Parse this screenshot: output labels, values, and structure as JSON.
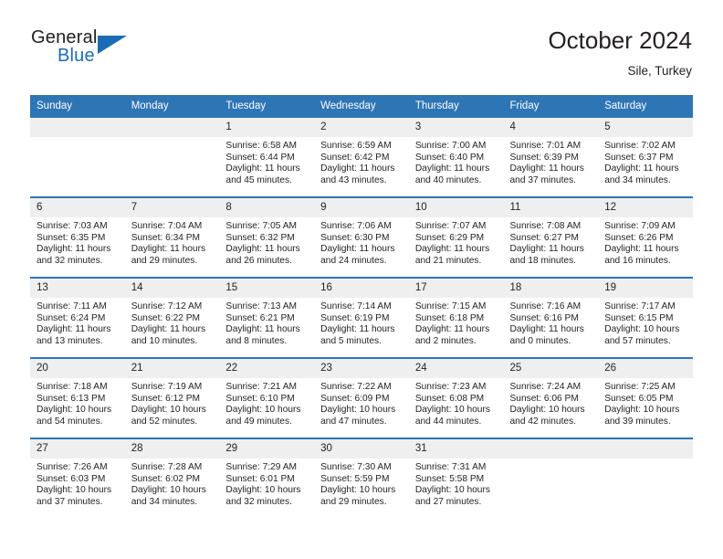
{
  "brand": {
    "name_top": "General",
    "name_bottom": "Blue",
    "accent_color": "#1b6cb5",
    "logo_icon": "blue-triangle-icon"
  },
  "header": {
    "title": "October 2024",
    "subtitle": "Sile, Turkey"
  },
  "colors": {
    "header_row_background": "#2e75b6",
    "header_row_text": "#ffffff",
    "daynumber_band_background": "#efefef",
    "cell_divider": "#2e75b6",
    "body_text": "#231f20"
  },
  "weekday_headers": [
    "Sunday",
    "Monday",
    "Tuesday",
    "Wednesday",
    "Thursday",
    "Friday",
    "Saturday"
  ],
  "weeks": [
    [
      {
        "day": "",
        "sunrise": "",
        "sunset": "",
        "daylight_line1": "",
        "daylight_line2": ""
      },
      {
        "day": "",
        "sunrise": "",
        "sunset": "",
        "daylight_line1": "",
        "daylight_line2": ""
      },
      {
        "day": "1",
        "sunrise": "Sunrise: 6:58 AM",
        "sunset": "Sunset: 6:44 PM",
        "daylight_line1": "Daylight: 11 hours",
        "daylight_line2": "and 45 minutes."
      },
      {
        "day": "2",
        "sunrise": "Sunrise: 6:59 AM",
        "sunset": "Sunset: 6:42 PM",
        "daylight_line1": "Daylight: 11 hours",
        "daylight_line2": "and 43 minutes."
      },
      {
        "day": "3",
        "sunrise": "Sunrise: 7:00 AM",
        "sunset": "Sunset: 6:40 PM",
        "daylight_line1": "Daylight: 11 hours",
        "daylight_line2": "and 40 minutes."
      },
      {
        "day": "4",
        "sunrise": "Sunrise: 7:01 AM",
        "sunset": "Sunset: 6:39 PM",
        "daylight_line1": "Daylight: 11 hours",
        "daylight_line2": "and 37 minutes."
      },
      {
        "day": "5",
        "sunrise": "Sunrise: 7:02 AM",
        "sunset": "Sunset: 6:37 PM",
        "daylight_line1": "Daylight: 11 hours",
        "daylight_line2": "and 34 minutes."
      }
    ],
    [
      {
        "day": "6",
        "sunrise": "Sunrise: 7:03 AM",
        "sunset": "Sunset: 6:35 PM",
        "daylight_line1": "Daylight: 11 hours",
        "daylight_line2": "and 32 minutes."
      },
      {
        "day": "7",
        "sunrise": "Sunrise: 7:04 AM",
        "sunset": "Sunset: 6:34 PM",
        "daylight_line1": "Daylight: 11 hours",
        "daylight_line2": "and 29 minutes."
      },
      {
        "day": "8",
        "sunrise": "Sunrise: 7:05 AM",
        "sunset": "Sunset: 6:32 PM",
        "daylight_line1": "Daylight: 11 hours",
        "daylight_line2": "and 26 minutes."
      },
      {
        "day": "9",
        "sunrise": "Sunrise: 7:06 AM",
        "sunset": "Sunset: 6:30 PM",
        "daylight_line1": "Daylight: 11 hours",
        "daylight_line2": "and 24 minutes."
      },
      {
        "day": "10",
        "sunrise": "Sunrise: 7:07 AM",
        "sunset": "Sunset: 6:29 PM",
        "daylight_line1": "Daylight: 11 hours",
        "daylight_line2": "and 21 minutes."
      },
      {
        "day": "11",
        "sunrise": "Sunrise: 7:08 AM",
        "sunset": "Sunset: 6:27 PM",
        "daylight_line1": "Daylight: 11 hours",
        "daylight_line2": "and 18 minutes."
      },
      {
        "day": "12",
        "sunrise": "Sunrise: 7:09 AM",
        "sunset": "Sunset: 6:26 PM",
        "daylight_line1": "Daylight: 11 hours",
        "daylight_line2": "and 16 minutes."
      }
    ],
    [
      {
        "day": "13",
        "sunrise": "Sunrise: 7:11 AM",
        "sunset": "Sunset: 6:24 PM",
        "daylight_line1": "Daylight: 11 hours",
        "daylight_line2": "and 13 minutes."
      },
      {
        "day": "14",
        "sunrise": "Sunrise: 7:12 AM",
        "sunset": "Sunset: 6:22 PM",
        "daylight_line1": "Daylight: 11 hours",
        "daylight_line2": "and 10 minutes."
      },
      {
        "day": "15",
        "sunrise": "Sunrise: 7:13 AM",
        "sunset": "Sunset: 6:21 PM",
        "daylight_line1": "Daylight: 11 hours",
        "daylight_line2": "and 8 minutes."
      },
      {
        "day": "16",
        "sunrise": "Sunrise: 7:14 AM",
        "sunset": "Sunset: 6:19 PM",
        "daylight_line1": "Daylight: 11 hours",
        "daylight_line2": "and 5 minutes."
      },
      {
        "day": "17",
        "sunrise": "Sunrise: 7:15 AM",
        "sunset": "Sunset: 6:18 PM",
        "daylight_line1": "Daylight: 11 hours",
        "daylight_line2": "and 2 minutes."
      },
      {
        "day": "18",
        "sunrise": "Sunrise: 7:16 AM",
        "sunset": "Sunset: 6:16 PM",
        "daylight_line1": "Daylight: 11 hours",
        "daylight_line2": "and 0 minutes."
      },
      {
        "day": "19",
        "sunrise": "Sunrise: 7:17 AM",
        "sunset": "Sunset: 6:15 PM",
        "daylight_line1": "Daylight: 10 hours",
        "daylight_line2": "and 57 minutes."
      }
    ],
    [
      {
        "day": "20",
        "sunrise": "Sunrise: 7:18 AM",
        "sunset": "Sunset: 6:13 PM",
        "daylight_line1": "Daylight: 10 hours",
        "daylight_line2": "and 54 minutes."
      },
      {
        "day": "21",
        "sunrise": "Sunrise: 7:19 AM",
        "sunset": "Sunset: 6:12 PM",
        "daylight_line1": "Daylight: 10 hours",
        "daylight_line2": "and 52 minutes."
      },
      {
        "day": "22",
        "sunrise": "Sunrise: 7:21 AM",
        "sunset": "Sunset: 6:10 PM",
        "daylight_line1": "Daylight: 10 hours",
        "daylight_line2": "and 49 minutes."
      },
      {
        "day": "23",
        "sunrise": "Sunrise: 7:22 AM",
        "sunset": "Sunset: 6:09 PM",
        "daylight_line1": "Daylight: 10 hours",
        "daylight_line2": "and 47 minutes."
      },
      {
        "day": "24",
        "sunrise": "Sunrise: 7:23 AM",
        "sunset": "Sunset: 6:08 PM",
        "daylight_line1": "Daylight: 10 hours",
        "daylight_line2": "and 44 minutes."
      },
      {
        "day": "25",
        "sunrise": "Sunrise: 7:24 AM",
        "sunset": "Sunset: 6:06 PM",
        "daylight_line1": "Daylight: 10 hours",
        "daylight_line2": "and 42 minutes."
      },
      {
        "day": "26",
        "sunrise": "Sunrise: 7:25 AM",
        "sunset": "Sunset: 6:05 PM",
        "daylight_line1": "Daylight: 10 hours",
        "daylight_line2": "and 39 minutes."
      }
    ],
    [
      {
        "day": "27",
        "sunrise": "Sunrise: 7:26 AM",
        "sunset": "Sunset: 6:03 PM",
        "daylight_line1": "Daylight: 10 hours",
        "daylight_line2": "and 37 minutes."
      },
      {
        "day": "28",
        "sunrise": "Sunrise: 7:28 AM",
        "sunset": "Sunset: 6:02 PM",
        "daylight_line1": "Daylight: 10 hours",
        "daylight_line2": "and 34 minutes."
      },
      {
        "day": "29",
        "sunrise": "Sunrise: 7:29 AM",
        "sunset": "Sunset: 6:01 PM",
        "daylight_line1": "Daylight: 10 hours",
        "daylight_line2": "and 32 minutes."
      },
      {
        "day": "30",
        "sunrise": "Sunrise: 7:30 AM",
        "sunset": "Sunset: 5:59 PM",
        "daylight_line1": "Daylight: 10 hours",
        "daylight_line2": "and 29 minutes."
      },
      {
        "day": "31",
        "sunrise": "Sunrise: 7:31 AM",
        "sunset": "Sunset: 5:58 PM",
        "daylight_line1": "Daylight: 10 hours",
        "daylight_line2": "and 27 minutes."
      },
      {
        "day": "",
        "sunrise": "",
        "sunset": "",
        "daylight_line1": "",
        "daylight_line2": ""
      },
      {
        "day": "",
        "sunrise": "",
        "sunset": "",
        "daylight_line1": "",
        "daylight_line2": ""
      }
    ]
  ]
}
